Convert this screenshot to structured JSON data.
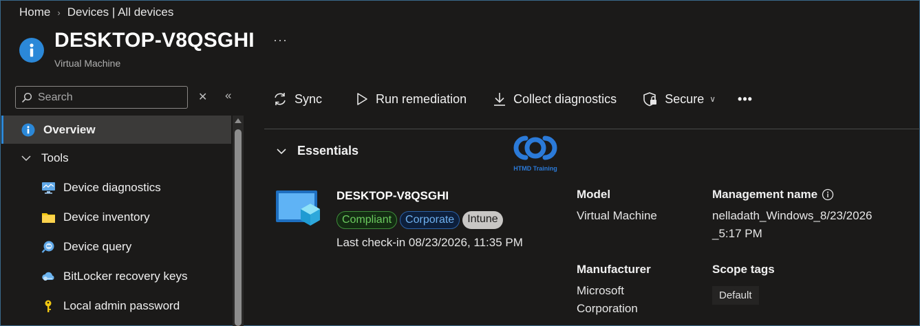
{
  "breadcrumb": {
    "home": "Home",
    "current": "Devices | All devices"
  },
  "header": {
    "title": "DESKTOP-V8QSGHI",
    "subtitle": "Virtual Machine",
    "more": "···"
  },
  "sidebar": {
    "search_placeholder": "Search",
    "items": [
      {
        "label": "Overview",
        "icon": "info-icon",
        "selected": true
      },
      {
        "label": "Tools",
        "icon": "chevron-down-icon"
      },
      {
        "label": "Device diagnostics",
        "icon": "monitor-icon"
      },
      {
        "label": "Device inventory",
        "icon": "folder-icon"
      },
      {
        "label": "Device query",
        "icon": "query-icon"
      },
      {
        "label": "BitLocker recovery keys",
        "icon": "cloud-key-icon"
      },
      {
        "label": "Local admin password",
        "icon": "key-icon"
      }
    ]
  },
  "toolbar": {
    "sync": "Sync",
    "run_remediation": "Run remediation",
    "collect_diagnostics": "Collect diagnostics",
    "secure": "Secure",
    "more": "•••"
  },
  "essentials": {
    "heading": "Essentials",
    "watermark": "HTMD Training",
    "device_name": "DESKTOP-V8QSGHI",
    "badges": [
      "Compliant",
      "Corporate",
      "Intune"
    ],
    "last_checkin": "Last check-in 08/23/2026, 11:35 PM",
    "model_label": "Model",
    "model_value": "Virtual Machine",
    "management_name_label": "Management name",
    "management_name_value_line1": "nelladath_Windows_8/23/2026",
    "management_name_value_line2": "_5:17 PM",
    "manufacturer_label": "Manufacturer",
    "manufacturer_value_line1": "Microsoft",
    "manufacturer_value_line2": "Corporation",
    "scope_tags_label": "Scope tags",
    "scope_tag_value": "Default"
  },
  "colors": {
    "accent": "#2b88d8",
    "compliant": "#6ccb5f",
    "corporate": "#6fb1f0",
    "background": "#1b1a19"
  }
}
